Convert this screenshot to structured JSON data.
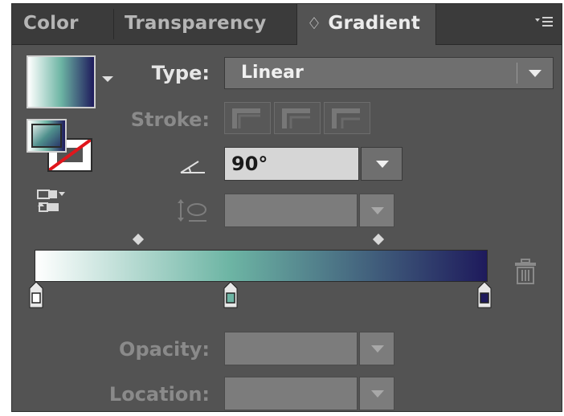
{
  "tabs": [
    {
      "label": "Color",
      "active": false
    },
    {
      "label": "Transparency",
      "active": false
    },
    {
      "label": "Gradient",
      "active": true
    }
  ],
  "active_tab_prefix": "♢",
  "menu_icon": "panel-menu-icon",
  "type": {
    "label": "Type:",
    "value": "Linear"
  },
  "stroke": {
    "label": "Stroke:"
  },
  "angle": {
    "value": "90°"
  },
  "aspect": {
    "value": ""
  },
  "opacity": {
    "label": "Opacity:",
    "value": ""
  },
  "location": {
    "label": "Location:",
    "value": ""
  },
  "gradient": {
    "stops": [
      {
        "color": "#ffffff",
        "location": 0
      },
      {
        "color": "#6db5a4",
        "location": 43
      },
      {
        "color": "#1e1a5c",
        "location": 100
      }
    ]
  },
  "colors": {
    "panel_bg": "#535353",
    "tab_bg": "#3b3b3b",
    "select_bg": "#6f6f6f",
    "stroke_slash": "#e0161c"
  }
}
